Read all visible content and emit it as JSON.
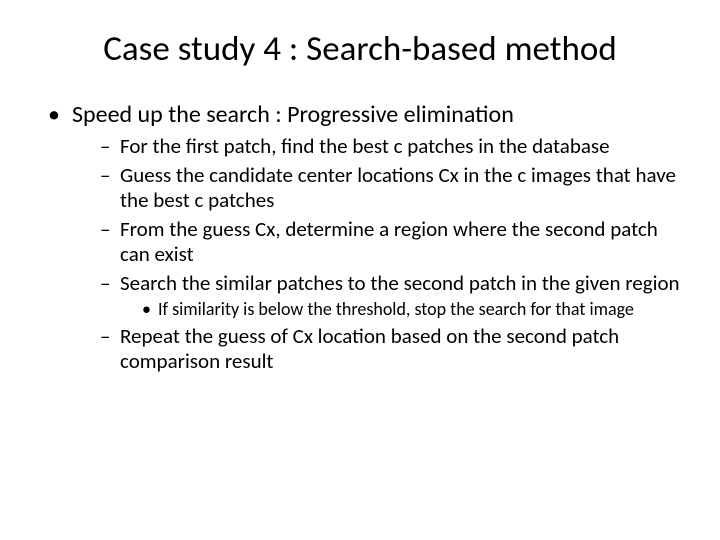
{
  "title": "Case study 4 : Search-based method",
  "bullet1": "Speed up the search : Progressive elimination",
  "sub1": "For the first patch, find the best c patches in the database",
  "sub2": "Guess the candidate center locations Cx in the c images that have the best c patches",
  "sub3": "From the guess Cx, determine a region where the second patch can exist",
  "sub4": "Search the similar patches to the second patch in the given region",
  "subsub1": "If similarity is below the threshold, stop the search for that image",
  "sub5": "Repeat the guess of Cx location based on the second patch comparison result"
}
